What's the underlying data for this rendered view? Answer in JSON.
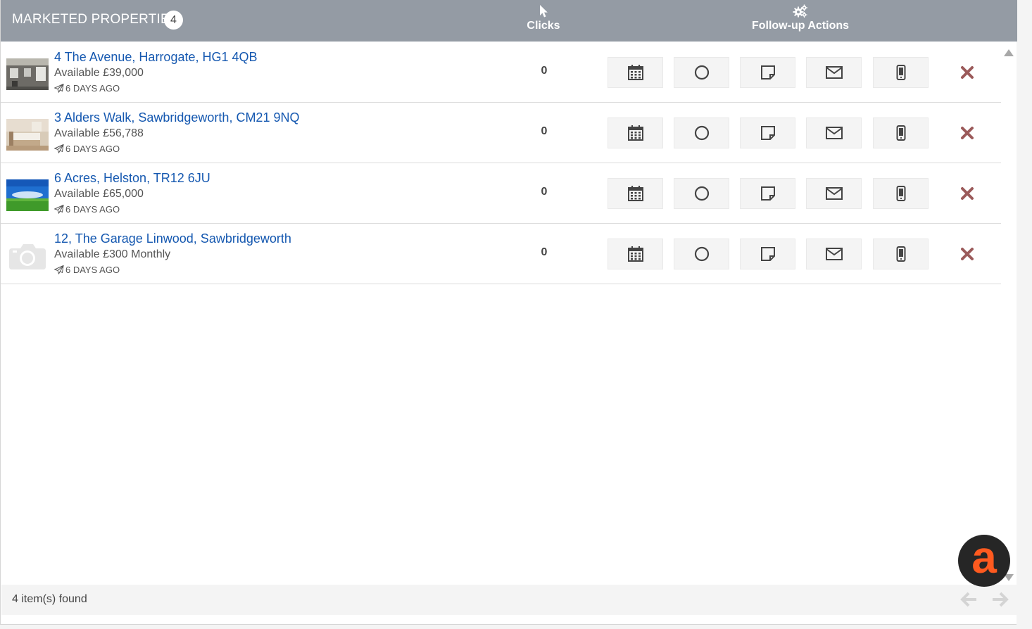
{
  "header": {
    "title": "MARKETED PROPERTIES",
    "count": "4",
    "col_clicks": "Clicks",
    "col_follow_up": "Follow-up Actions",
    "clicks_icon": "cursor-pointer-icon",
    "follow_up_icon": "gears-icon"
  },
  "properties": [
    {
      "address": "4 The Avenue, Harrogate, HG1 4QB",
      "availability": "Available £39,000",
      "sent": "6 DAYS AGO",
      "clicks": "0",
      "thumbnail": "terraced-house-photo"
    },
    {
      "address": "3 Alders Walk, Sawbridgeworth, CM21 9NQ",
      "availability": "Available £56,788",
      "sent": "6 DAYS AGO",
      "clicks": "0",
      "thumbnail": "bedroom-interior-photo"
    },
    {
      "address": "6 Acres, Helston, TR12 6JU",
      "availability": "Available £65,000",
      "sent": "6 DAYS AGO",
      "clicks": "0",
      "thumbnail": "green-field-sky-photo"
    },
    {
      "address": "12, The Garage Linwood, Sawbridgeworth",
      "availability": "Available £300 Monthly",
      "sent": "6 DAYS AGO",
      "clicks": "0",
      "thumbnail": "camera-placeholder"
    }
  ],
  "actions": [
    "calendar-icon",
    "circle-icon",
    "note-icon",
    "envelope-icon",
    "mobile-phone-icon",
    "remove-x-icon"
  ],
  "footer": {
    "found_text": "4 item(s) found",
    "prev_icon": "arrow-left-icon",
    "next_icon": "arrow-right-icon"
  },
  "colors": {
    "header_bg": "#949ba4",
    "link": "#1558b0",
    "remove": "#9b5a5a",
    "brand_orange": "#ff5a1f"
  },
  "brand_badge": {
    "glyph": "a"
  }
}
